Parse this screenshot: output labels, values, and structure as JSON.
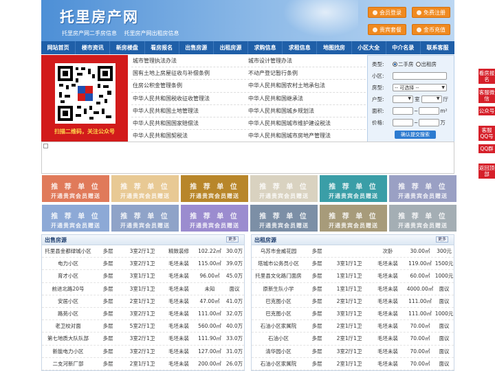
{
  "header": {
    "logo": "托里房产网",
    "sub_links": [
      "托里房产网二手房信息",
      "托里房产网出租房信息"
    ],
    "buttons": [
      "会员登录",
      "免费注册",
      "贵宾套餐",
      "金币充值"
    ]
  },
  "nav": [
    "网站首页",
    "楼市资讯",
    "新房楼盘",
    "看房报名",
    "出售房源",
    "出租房源",
    "求购信息",
    "求租信息",
    "地图找房",
    "小区大全",
    "中介名录",
    "联系客服"
  ],
  "qr_caption": "扫描二维码，关注公众号",
  "links": [
    [
      "城市管理执法办法",
      "城市设计管理办法"
    ],
    [
      "国有土地上房屋征收与补偿条例",
      "不动产登记暂行条例"
    ],
    [
      "住房公积金管理条例",
      "中华人民共和国农村土地承包法"
    ],
    [
      "中华人民共和国税收征收管理法",
      "中华人民共和国继承法"
    ],
    [
      "中华人民共和国土地管理法",
      "中华人民共和国城乡规划法"
    ],
    [
      "中华人民共和国国家赔偿法",
      "中华人民共和国城市维护建设税法"
    ],
    [
      "中华人民共和国契税法",
      "中华人民共和国城市房地产管理法"
    ]
  ],
  "search": {
    "type_label": "类型:",
    "type_options": [
      "二手房",
      "出租房"
    ],
    "community_label": "小区:",
    "house_label": "房型:",
    "house_select": "-- 可选择 --",
    "layout_label": "户型:",
    "layout_room": "室",
    "layout_hall": "厅",
    "area_label": "面积:",
    "area_unit": "m²",
    "price_label": "价格:",
    "price_unit": "万",
    "range_sep": "~",
    "submit": "确认提交搜索"
  },
  "ads": {
    "title": "推 荐 单 位",
    "sub": "开通贵宾会员赠送",
    "colors": [
      "#e07a5a",
      "#e8c994",
      "#b8862a",
      "#d9d2c0",
      "#3a9ea7",
      "#9aa0c4",
      "#8da9d6",
      "#8fa3c8",
      "#9b8ccf",
      "#7c8fa6",
      "#a79b7a",
      "#a4aeb4"
    ]
  },
  "sale": {
    "title": "出售房源",
    "more": "更多",
    "rows": [
      [
        "托里县金都绿城小区",
        "多层",
        "3室2厅1卫",
        "精致装修",
        "102.22㎡",
        "30.0万"
      ],
      [
        "电力小区",
        "多层",
        "3室2厅1卫",
        "毛坯未装",
        "115.00㎡",
        "39.0万"
      ],
      [
        "育才小区",
        "多层",
        "3室1厅1卫",
        "毛坯未装",
        "96.00㎡",
        "45.0万"
      ],
      [
        "前进北路20号",
        "多层",
        "3室1厅1卫",
        "毛坯未装",
        "未知",
        "面议"
      ],
      [
        "安居小区",
        "多层",
        "2室1厅1卫",
        "毛坯未装",
        "47.00㎡",
        "41.0万"
      ],
      [
        "路苑小区",
        "多层",
        "3室2厅1卫",
        "毛坯未装",
        "111.00㎡",
        "32.0万"
      ],
      [
        "老卫校对面",
        "多层",
        "5室2厅1卫",
        "毛坯未装",
        "560.00㎡",
        "40.0万"
      ],
      [
        "第七地质大队队部",
        "多层",
        "3室2厅1卫",
        "毛坯未装",
        "111.90㎡",
        "33.0万"
      ],
      [
        "新能电力小区",
        "多层",
        "3室2厅1卫",
        "毛坯未装",
        "127.00㎡",
        "31.0万"
      ],
      [
        "二支河新厂部",
        "多层",
        "2室1厅1卫",
        "毛坯未装",
        "200.00㎡",
        "26.0万"
      ]
    ]
  },
  "rent": {
    "title": "出租房源",
    "more": "更多",
    "rows": [
      [
        "乌苏市金威花园",
        "多层",
        "",
        "次卧",
        "30.00㎡",
        "300元"
      ],
      [
        "塔城市公务员小区",
        "多层",
        "3室1厅1卫",
        "毛坯未装",
        "119.00㎡",
        "1500元"
      ],
      [
        "托里县文化路门面房",
        "多层",
        "1室1厅1卫",
        "毛坯未装",
        "60.00㎡",
        "1000元"
      ],
      [
        "原新生队小学",
        "多层",
        "1室1厅1卫",
        "毛坯未装",
        "4000.00㎡",
        "面议"
      ],
      [
        "巴克图小区",
        "多层",
        "2室1厅1卫",
        "毛坯未装",
        "111.00㎡",
        "面议"
      ],
      [
        "巴克图小区",
        "多层",
        "3室1厅1卫",
        "毛坯未装",
        "111.00㎡",
        "1000元"
      ],
      [
        "石油小区家属院",
        "多层",
        "2室1厅1卫",
        "毛坯未装",
        "70.00㎡",
        "面议"
      ],
      [
        "石油小区",
        "多层",
        "2室1厅1卫",
        "毛坯未装",
        "70.00㎡",
        "面议"
      ],
      [
        "清华园小区",
        "多层",
        "3室2厅1卫",
        "毛坯未装",
        "70.00㎡",
        "面议"
      ],
      [
        "石油小区家属院",
        "多层",
        "2室1厅1卫",
        "毛坯未装",
        "70.00㎡",
        "面议"
      ]
    ]
  },
  "sidebar": [
    "看房报名",
    "客服微信",
    "公众号",
    "客服QQ号",
    "QQ群",
    "返回顶部"
  ]
}
